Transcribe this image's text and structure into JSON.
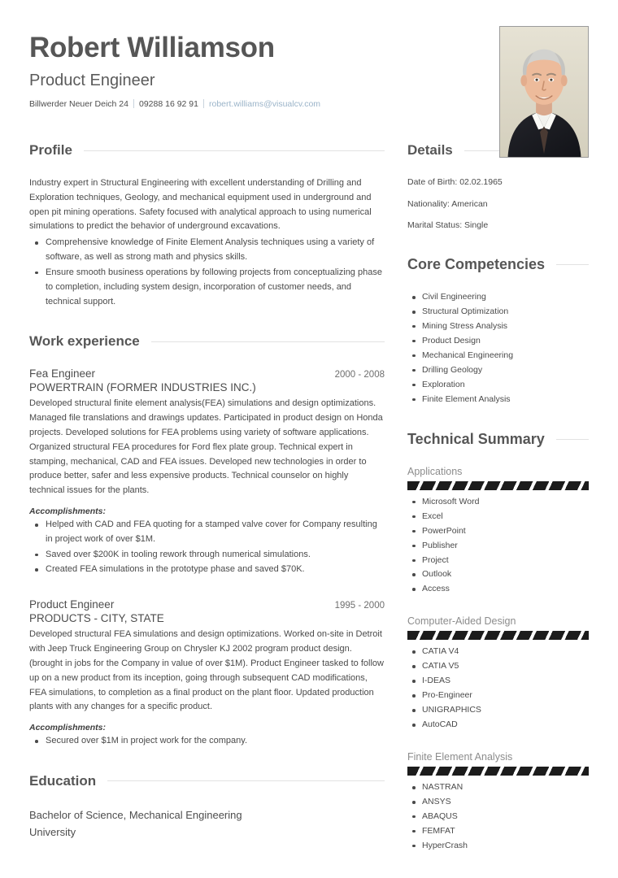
{
  "header": {
    "name": "Robert Williamson",
    "job_title": "Product Engineer",
    "address": "Billwerder Neuer Deich 24",
    "phone": "09288 16 92 91",
    "email": "robert.williams@visualcv.com",
    "photo_alt": "portrait-photo-of-man-in-dark-suit",
    "email_color": "#9bb4c9"
  },
  "profile": {
    "heading": "Profile",
    "paragraph": "Industry expert in Structural Engineering with excellent understanding of Drilling and Exploration techniques, Geology, and mechanical equipment used in underground and open pit mining operations. Safety focused with analytical approach to using numerical simulations to predict the behavior of underground excavations.",
    "bullets": [
      "Comprehensive knowledge of Finite Element Analysis techniques using a variety of software, as well as strong math and physics skills.",
      "Ensure smooth business operations by following projects from conceptualizing phase to completion, including system design, incorporation of customer needs, and technical support."
    ]
  },
  "work_experience": {
    "heading": "Work experience",
    "accomplishments_label": "Accomplishments:",
    "jobs": [
      {
        "role": "Fea Engineer",
        "dates": "2000 - 2008",
        "company": "POWERTRAIN (FORMER INDUSTRIES INC.)",
        "description": "Developed structural finite element analysis(FEA) simulations and design optimizations. Managed file translations and drawings updates. Participated in product design on Honda projects. Developed solutions for FEA problems using variety of software applications. Organized structural FEA procedures for Ford flex plate group. Technical expert in stamping, mechanical, CAD and FEA issues. Developed new technologies in order to produce better, safer and less expensive products. Technical counselor on highly technical issues for the plants.",
        "accomplishments": [
          "Helped with CAD and FEA quoting for a stamped valve cover for Company resulting in project work of over $1M.",
          "Saved over $200K in tooling rework through numerical simulations.",
          "Created FEA simulations in the prototype phase and saved $70K."
        ]
      },
      {
        "role": "Product Engineer",
        "dates": "1995 - 2000",
        "company": "PRODUCTS - CITY, STATE",
        "description": "Developed structural FEA simulations and design optimizations. Worked on-site in Detroit with Jeep Truck Engineering Group on Chrysler KJ 2002 program product design. (brought in jobs for the Company in value of over $1M). Product Engineer tasked to follow up on a new product from its inception, going through subsequent CAD modifications, FEA simulations, to completion as a final product on the plant floor. Updated production plants with any changes for a specific product.",
        "accomplishments": [
          "Secured over $1M in project work for the company."
        ]
      }
    ]
  },
  "education": {
    "heading": "Education",
    "degree": "Bachelor of Science, Mechanical Engineering",
    "school": "University"
  },
  "details": {
    "heading": "Details",
    "date_of_birth": "Date of Birth: 02.02.1965",
    "nationality": "Nationality: American",
    "marital_status": "Marital Status: Single"
  },
  "core_competencies": {
    "heading": "Core Competencies",
    "items": [
      "Civil Engineering",
      "Structural Optimization",
      "Mining Stress Analysis",
      "Product Design",
      "Mechanical Engineering",
      "Drilling Geology",
      "Exploration",
      "Finite Element Analysis"
    ]
  },
  "technical_summary": {
    "heading": "Technical Summary",
    "groups": [
      {
        "label": "Applications",
        "items": [
          "Microsoft Word",
          "Excel",
          "PowerPoint",
          "Publisher",
          "Project",
          "Outlook",
          "Access"
        ]
      },
      {
        "label": "Computer-Aided Design",
        "items": [
          "CATIA V4",
          "CATIA V5",
          "I-DEAS",
          "Pro-Engineer",
          "UNIGRAPHICS",
          "AutoCAD"
        ]
      },
      {
        "label": "Finite Element Analysis",
        "items": [
          "NASTRAN",
          "ANSYS",
          "ABAQUS",
          "FEMFAT",
          "HyperCrash"
        ]
      }
    ]
  }
}
